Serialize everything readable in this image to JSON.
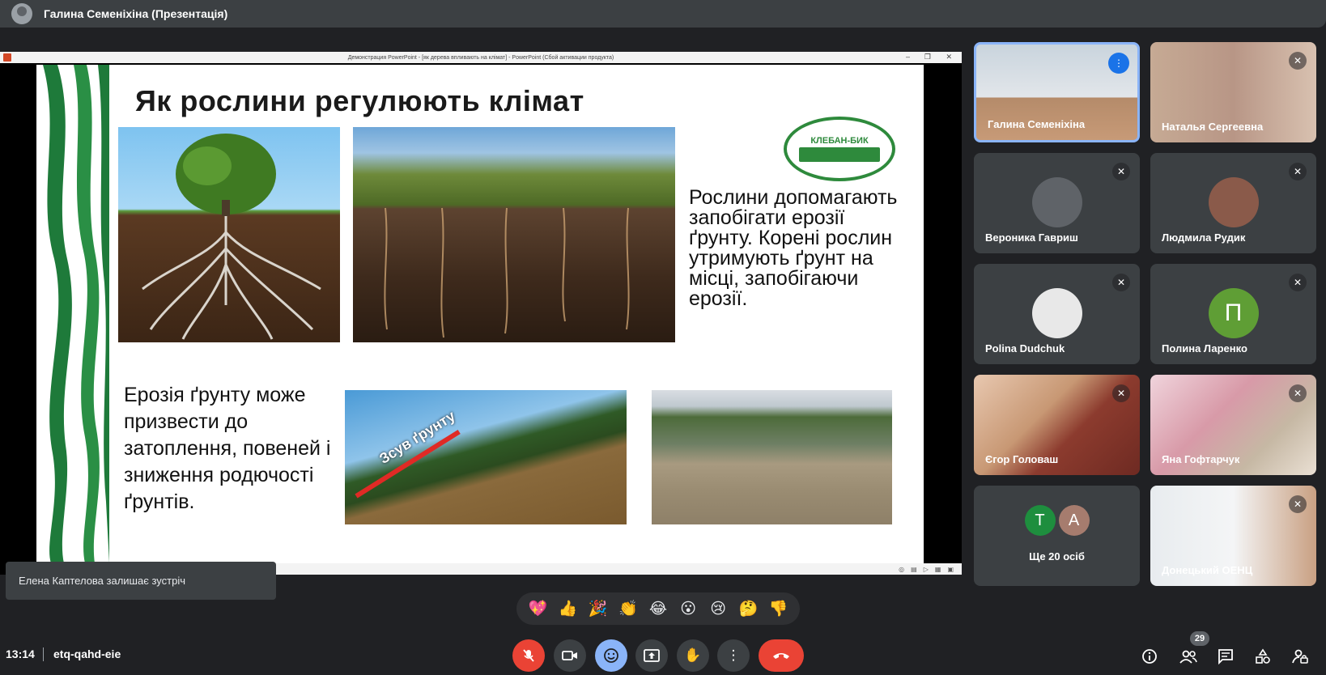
{
  "header": {
    "presenter_title": "Галина Семеніхіна (Презентація)"
  },
  "presentation": {
    "window_title": "Демонстрация PowerPoint - [як дерева впливають на клімат] - PowerPoint (Сбой активации продукта)",
    "slide": {
      "title": "Як рослини регулюють клімат",
      "text_right": "Рослини допомагають запобігати ерозії ґрунту. Корені рослин утримують ґрунт на місці, запобігаючи ерозії.",
      "text_left": "Ерозія ґрунту може призвести до затоплення, повеней і зниження родючості ґрунтів.",
      "arrow_label": "Зсув ґрунту",
      "logo_text": "КЛЕБАН-БИК"
    }
  },
  "participants": [
    {
      "name": "Галина Семеніхіна",
      "status": "speaking",
      "icon": "audio-level-icon"
    },
    {
      "name": "Наталья Сергеевна",
      "status": "muted",
      "icon": "mic-off-icon"
    },
    {
      "name": "Вероника Гавриш",
      "status": "muted",
      "icon": "mic-off-icon"
    },
    {
      "name": "Людмила Рудик",
      "status": "muted",
      "icon": "mic-off-icon"
    },
    {
      "name": "Polina Dudchuk",
      "status": "muted",
      "icon": "mic-off-icon"
    },
    {
      "name": "Полина Ларенко",
      "status": "muted",
      "icon": "mic-off-icon",
      "initial": "П",
      "avatar_color": "#5f9e35"
    },
    {
      "name": "Єгор Головаш",
      "status": "muted",
      "icon": "mic-off-icon"
    },
    {
      "name": "Яна Гофтарчук",
      "status": "muted",
      "icon": "mic-off-icon"
    },
    {
      "name": "Донецький ОЕНЦ",
      "status": "muted",
      "icon": "mic-off-icon"
    }
  ],
  "more_participants": {
    "label": "Ще 20 осіб",
    "initials": [
      {
        "letter": "Т",
        "color": "#1e8e3e"
      },
      {
        "letter": "А",
        "color": "#a67c6e"
      }
    ]
  },
  "toast": {
    "text": "Елена Каптелова залишає зустріч"
  },
  "reactions": [
    "💖",
    "👍",
    "🎉",
    "👏",
    "😂",
    "😮",
    "😢",
    "🤔",
    "👎"
  ],
  "bottom_bar": {
    "time": "13:14",
    "meeting_code": "etq-qahd-eie",
    "people_count": "29"
  },
  "colors": {
    "background": "#202124",
    "surface": "#3c4043",
    "accent_blue": "#8ab4f8",
    "speaking_blue": "#1a73e8",
    "danger_red": "#ea4335"
  }
}
